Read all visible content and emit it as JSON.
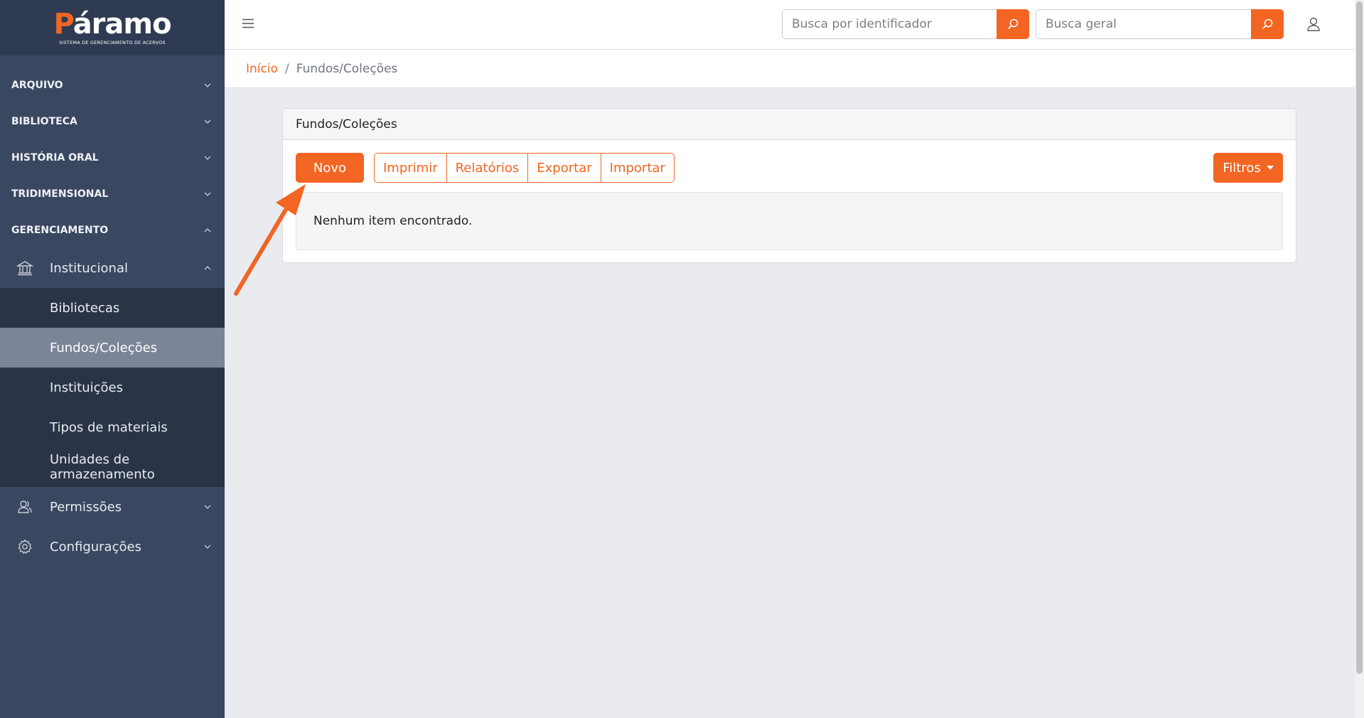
{
  "brand": {
    "name_prefix": "P",
    "name_rest": "áramo",
    "subtitle": "SISTEMA DE GERENCIAMENTO DE ACERVOS"
  },
  "sidebar": {
    "sections": [
      {
        "label": "ARQUIVO"
      },
      {
        "label": "BIBLIOTECA"
      },
      {
        "label": "HISTÓRIA ORAL"
      },
      {
        "label": "TRIDIMENSIONAL"
      },
      {
        "label": "GERENCIAMENTO"
      }
    ],
    "institucional": {
      "label": "Institucional",
      "items": [
        {
          "label": "Bibliotecas"
        },
        {
          "label": "Fundos/Coleções"
        },
        {
          "label": "Instituições"
        },
        {
          "label": "Tipos de materiais"
        },
        {
          "label": "Unidades de armazenamento"
        }
      ]
    },
    "permissoes": {
      "label": "Permissões"
    },
    "configuracoes": {
      "label": "Configurações"
    }
  },
  "topbar": {
    "search_id_placeholder": "Busca por identificador",
    "search_general_placeholder": "Busca geral"
  },
  "breadcrumb": {
    "home": "Início",
    "current": "Fundos/Coleções"
  },
  "card": {
    "title": "Fundos/Coleções",
    "new_button": "Novo",
    "group_buttons": [
      "Imprimir",
      "Relatórios",
      "Exportar",
      "Importar"
    ],
    "filters_button": "Filtros",
    "empty_message": "Nenhum item encontrado."
  },
  "colors": {
    "accent": "#f26522",
    "sidebar_bg": "#3a4760",
    "sidebar_inner_bg": "#2a3447",
    "active_item_bg": "#7b8597"
  }
}
